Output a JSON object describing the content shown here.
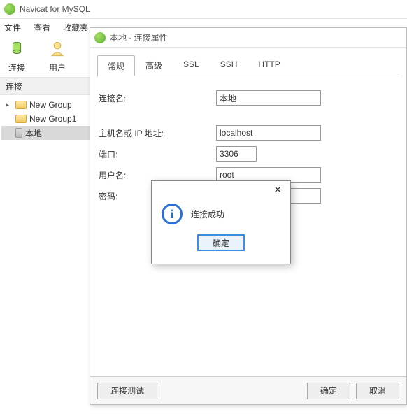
{
  "window": {
    "title": "Navicat for MySQL"
  },
  "menu": {
    "file": "文件",
    "view": "查看",
    "favorites": "收藏夹"
  },
  "toolbar": {
    "connect": "连接",
    "user": "用户"
  },
  "sidebar": {
    "title": "连接",
    "items": [
      {
        "label": "New Group"
      },
      {
        "label": "New Group1"
      },
      {
        "label": "本地"
      }
    ]
  },
  "dialog": {
    "title": "本地 - 连接属性",
    "tabs": {
      "general": "常规",
      "advanced": "高级",
      "ssl": "SSL",
      "ssh": "SSH",
      "http": "HTTP"
    },
    "labels": {
      "connection_name": "连接名:",
      "host": "主机名或 IP 地址:",
      "port": "端口:",
      "user": "用户名:",
      "password": "密码:"
    },
    "values": {
      "connection_name": "本地",
      "host": "localhost",
      "port": "3306",
      "user": "root",
      "password": "••••"
    },
    "buttons": {
      "test": "连接测试",
      "ok": "确定",
      "cancel": "取消"
    }
  },
  "msgbox": {
    "text": "连接成功",
    "ok": "确定"
  }
}
